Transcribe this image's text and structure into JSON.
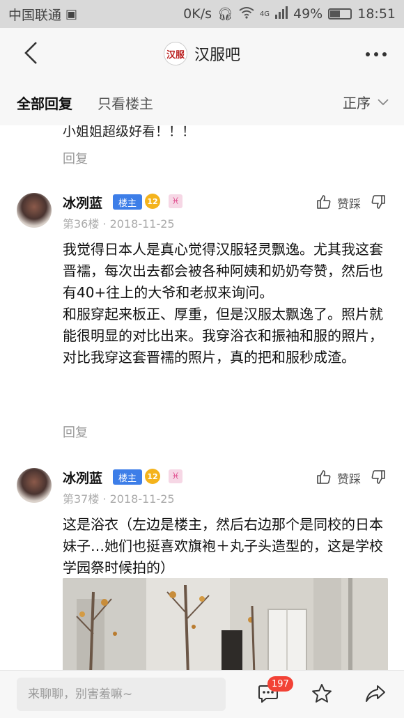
{
  "status_bar": {
    "carrier": "中国联通",
    "speed": "0K/s",
    "network": "4G",
    "battery": "49%",
    "battery_level": 0.49,
    "time": "18:51"
  },
  "nav": {
    "title": "汉服吧",
    "logo_text": "汉服"
  },
  "tabs": {
    "items": [
      {
        "label": "全部回复",
        "active": true
      },
      {
        "label": "只看楼主",
        "active": false
      }
    ],
    "sort_label": "正序"
  },
  "previous_post": {
    "text": "小姐姐超级好看！！！",
    "reply_label": "回复"
  },
  "posts": [
    {
      "username": "冰冽蓝",
      "badge": "楼主",
      "level": "12",
      "zodiac": "♓",
      "floor_date": "第36楼 · 2018-11-25",
      "like_label": "赞踩",
      "body": [
        "我觉得日本人是真心觉得汉服轻灵飘逸。尤其我这套晋襦，每次出去都会被各种阿姨和奶奶夸赞，然后也有40+往上的大爷和老叔来询问。",
        "和服穿起来板正、厚重，但是汉服太飘逸了。照片就能很明显的对比出来。我穿浴衣和振袖和服的照片，对比我穿这套晋襦的照片，真的把和服秒成渣。"
      ],
      "reply_label": "回复"
    },
    {
      "username": "冰冽蓝",
      "badge": "楼主",
      "level": "12",
      "zodiac": "♓",
      "floor_date": "第37楼 · 2018-11-25",
      "like_label": "赞踩",
      "body": [
        "这是浴衣（左边是楼主，然后右边那个是同校的日本妹子…她们也挺喜欢旗袍＋丸子头造型的，这是学校学园祭时候拍的）"
      ]
    }
  ],
  "bottom": {
    "placeholder": "来聊聊，别害羞嘛~",
    "comment_count": "197"
  },
  "colors": {
    "accent_blue": "#3d7ee8",
    "badge_red": "#f24236",
    "level_gold": "#f4b31c"
  }
}
